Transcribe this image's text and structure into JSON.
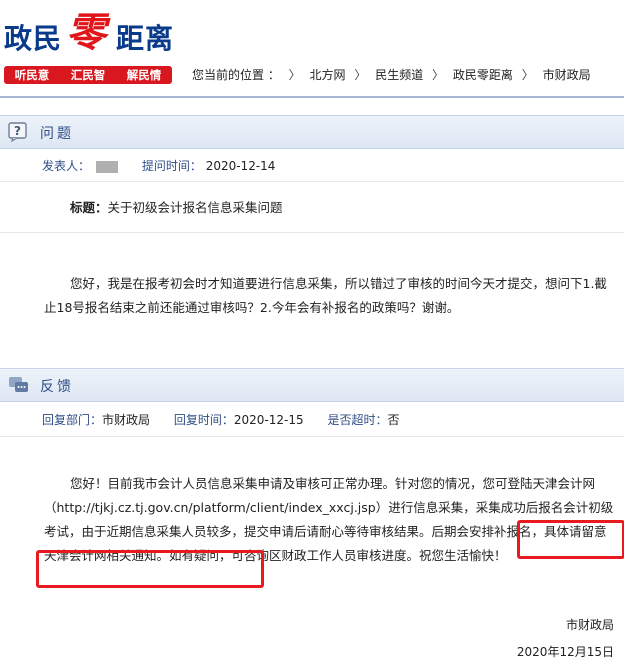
{
  "logo": {
    "part_a": "政民",
    "part_ling": "零",
    "part_b": "距离"
  },
  "slogans": [
    "听民意",
    "汇民智",
    "解民情"
  ],
  "breadcrumb": {
    "prefix": "您当前的位置 ：",
    "items": [
      "北方网",
      "民生频道",
      "政民零距离",
      "市财政局"
    ],
    "separator": "〉"
  },
  "question": {
    "section_title": "问题",
    "author_label": "发表人：",
    "time_label": "提问时间：",
    "time_value": "2020-12-14",
    "title_label": "标题：",
    "title_value": "关于初级会计报名信息采集问题",
    "body": "您好，我是在报考初会时才知道要进行信息采集，所以错过了审核的时间今天才提交，想问下1.截止18号报名结束之前还能通过审核吗？2.今年会有补报名的政策吗？谢谢。"
  },
  "feedback": {
    "section_title": "反馈",
    "dept_label": "回复部门：",
    "dept_value": "市财政局",
    "time_label": "回复时间：",
    "time_value": "2020-12-15",
    "timeout_label": "是否超时：",
    "timeout_value": "否",
    "body": "您好！目前我市会计人员信息采集申请及审核可正常办理。针对您的情况，您可登陆天津会计网（http://tjkj.cz.tj.gov.cn/platform/client/index_xxcj.jsp）进行信息采集，采集成功后报名会计初级考试，由于近期信息采集人员较多，提交申请后请耐心等待审核结果。后期会安排补报名，具体请留意天津会计网相关通知。如有疑问，可咨询区财政工作人员审核进度。祝您生活愉快！",
    "signature": "市财政局",
    "date": "2020年12月15日"
  }
}
